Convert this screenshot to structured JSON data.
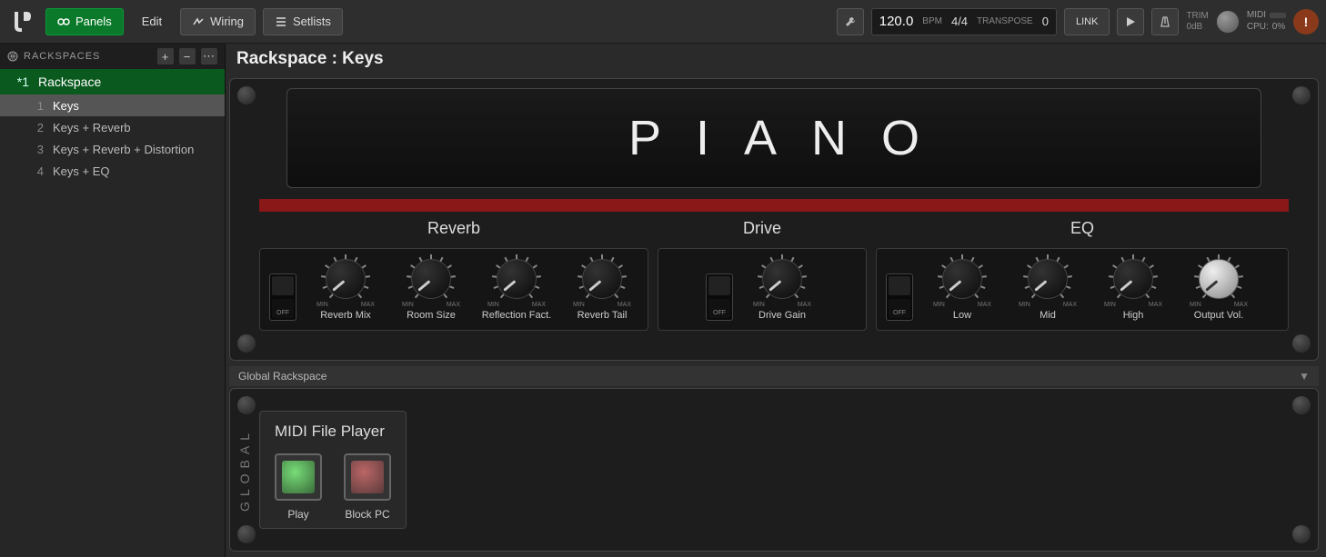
{
  "topbar": {
    "panels": "Panels",
    "edit": "Edit",
    "wiring": "Wiring",
    "setlists": "Setlists",
    "tempo": "120.0",
    "bpm": "BPM",
    "timesig": "4/4",
    "transpose_lbl": "TRANSPOSE",
    "transpose_val": "0",
    "link": "LINK",
    "trim": "TRIM",
    "trim_val": "0dB",
    "midi": "MIDI",
    "cpu": "CPU:",
    "cpu_val": "0%"
  },
  "sidebar": {
    "header": "RACKSPACES",
    "rack": {
      "num": "*1",
      "name": "Rackspace"
    },
    "variations": [
      {
        "num": "1",
        "name": "Keys",
        "selected": true
      },
      {
        "num": "2",
        "name": "Keys + Reverb",
        "selected": false
      },
      {
        "num": "3",
        "name": "Keys + Reverb + Distortion",
        "selected": false
      },
      {
        "num": "4",
        "name": "Keys + EQ",
        "selected": false
      }
    ]
  },
  "content": {
    "title": "Rackspace : Keys",
    "lcd": "PIANO",
    "sections": {
      "reverb": {
        "title": "Reverb",
        "toggle": "OFF",
        "knobs": [
          {
            "label": "Reverb Mix"
          },
          {
            "label": "Room Size"
          },
          {
            "label": "Reflection Fact."
          },
          {
            "label": "Reverb Tail"
          }
        ]
      },
      "drive": {
        "title": "Drive",
        "toggle": "OFF",
        "knobs": [
          {
            "label": "Drive Gain"
          }
        ]
      },
      "eq": {
        "title": "EQ",
        "toggle": "OFF",
        "knobs": [
          {
            "label": "Low"
          },
          {
            "label": "Mid"
          },
          {
            "label": "High"
          },
          {
            "label": "Output Vol.",
            "silver": true
          }
        ]
      }
    },
    "knob_min": "MIN",
    "knob_max": "MAX"
  },
  "global": {
    "header": "Global Rackspace",
    "vert": "GLOBAL",
    "midi_player": {
      "title": "MIDI File Player",
      "play": "Play",
      "block": "Block PC"
    }
  }
}
